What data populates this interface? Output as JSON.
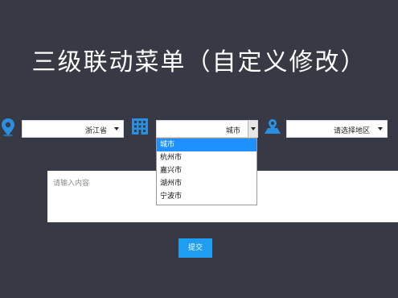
{
  "header": {
    "title": "三级联动菜单（自定义修改）"
  },
  "colors": {
    "background": "#373a44",
    "accent": "#1e9ef0"
  },
  "province_select": {
    "icon": "location-pin-icon",
    "value": "浙江省"
  },
  "city_select": {
    "icon": "building-icon",
    "value": "城市",
    "options": [
      "城市",
      "杭州市",
      "嘉兴市",
      "湖州市",
      "宁波市"
    ],
    "selected_index": 0
  },
  "district_select": {
    "icon": "map-location-icon",
    "value": "请选择地区"
  },
  "content": {
    "placeholder": "请输入内容"
  },
  "submit": {
    "label": "提交"
  }
}
